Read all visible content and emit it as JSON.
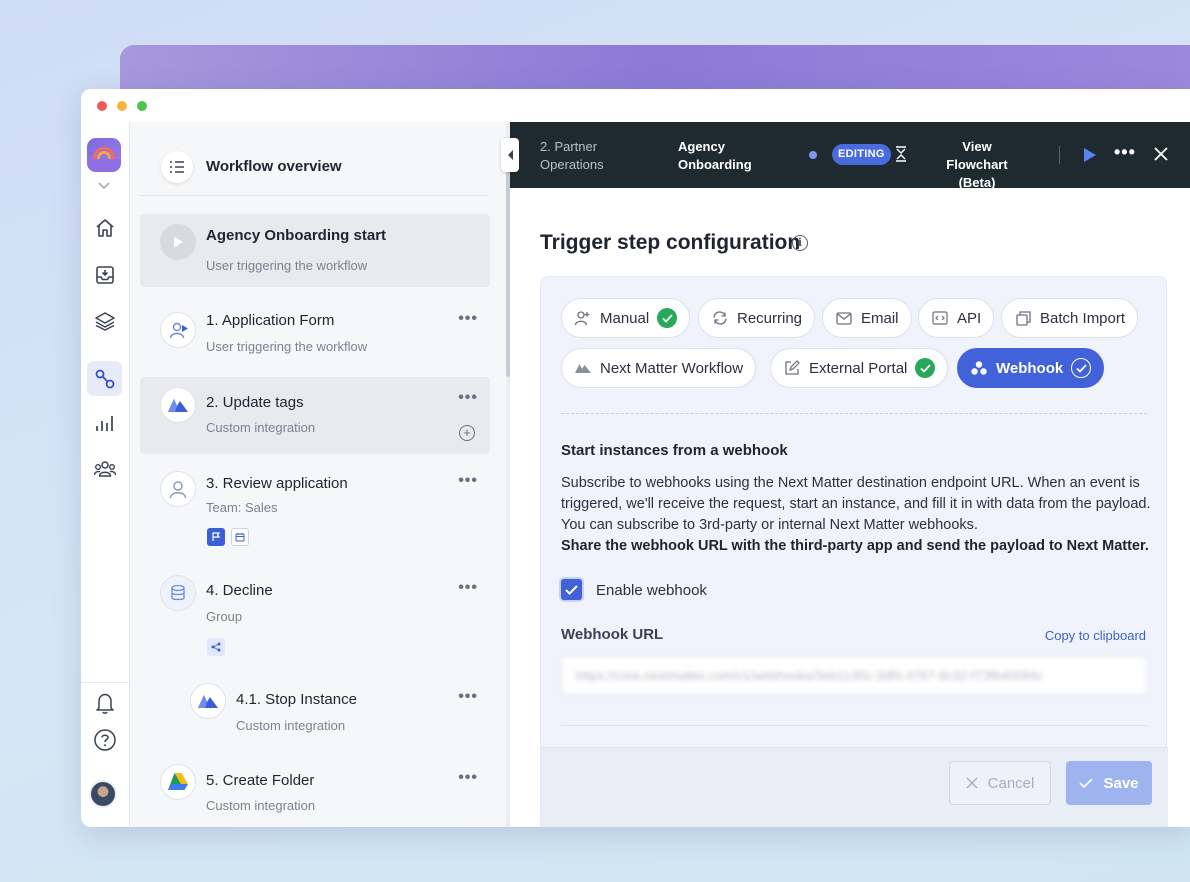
{
  "topbar": {
    "breadcrumb": "2. Partner Operations",
    "workflow_name": "Agency Onboarding",
    "status_badge": "EDITING",
    "flowchart_label": "View Flowchart (Beta)"
  },
  "overview": {
    "title": "Workflow overview"
  },
  "steps": [
    {
      "name": "Agency Onboarding start",
      "sub": "User triggering the workflow"
    },
    {
      "name": "1. Application Form",
      "sub": "User triggering the workflow"
    },
    {
      "name": "2. Update tags",
      "sub": "Custom integration"
    },
    {
      "name": "3. Review application",
      "sub": "Team: Sales"
    },
    {
      "name": "4. Decline",
      "sub": "Group"
    },
    {
      "name": "4.1. Stop Instance",
      "sub": "Custom integration"
    },
    {
      "name": "5. Create Folder",
      "sub": "Custom integration"
    }
  ],
  "config": {
    "title": "Trigger step configuration",
    "info_glyph": "i",
    "triggers": [
      {
        "label": "Manual",
        "enabled": true
      },
      {
        "label": "Recurring",
        "enabled": false
      },
      {
        "label": "Email",
        "enabled": false
      },
      {
        "label": "API",
        "enabled": false
      },
      {
        "label": "Batch Import",
        "enabled": false
      },
      {
        "label": "Next Matter Workflow",
        "enabled": false
      },
      {
        "label": "External Portal",
        "enabled": true
      },
      {
        "label": "Webhook",
        "enabled": true,
        "selected": true
      }
    ],
    "section_title": "Start instances from a webhook",
    "description": "Subscribe to webhooks using the Next Matter destination endpoint URL. When an event is triggered, we'll receive the request, start an instance, and fill it in with data from the payload. You can subscribe to 3rd-party or internal Next Matter webhooks.",
    "description_bold": "Share the webhook URL with the third-party app and send the payload to Next Matter.",
    "enable_label": "Enable webhook",
    "enable_checked": true,
    "url_label": "Webhook URL",
    "copy_label": "Copy to clipboard",
    "url_value": "https://core.nextmatter.com/v1/webhooks/3eb1135c-3df4-4767-8c32-f73fb40094c",
    "cancel_label": "Cancel",
    "save_label": "Save"
  },
  "colors": {
    "accent": "#4162d9",
    "topbar": "#1f2a30",
    "success": "#27a85b"
  }
}
